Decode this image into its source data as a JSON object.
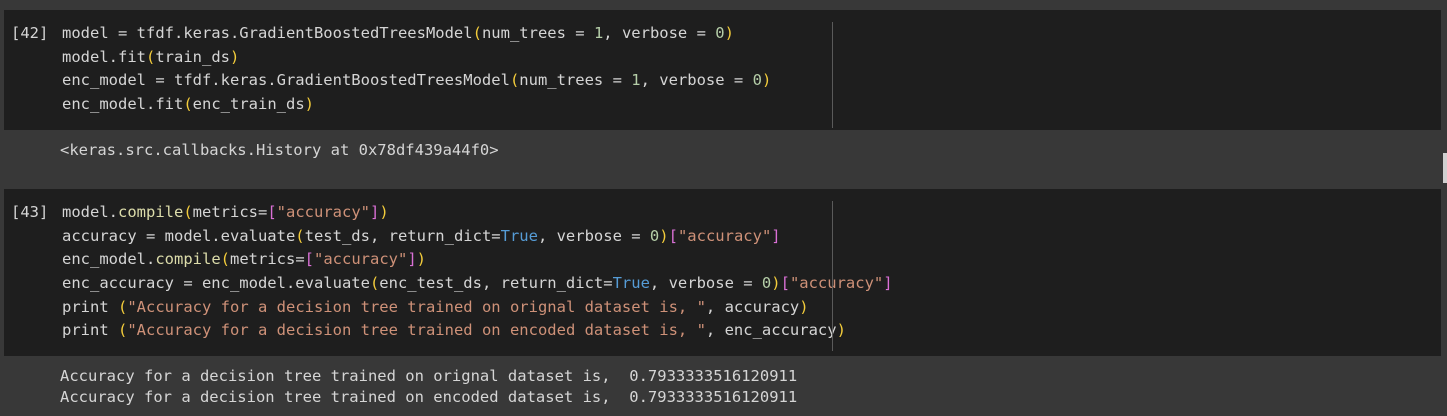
{
  "cells": [
    {
      "exec_count": "[42]",
      "lines": [
        [
          [
            "t",
            "model = tfdf.keras.GradientBoostedTreesModel"
          ],
          [
            "p",
            "("
          ],
          [
            "t",
            "num_trees = "
          ],
          [
            "n",
            "1"
          ],
          [
            "t",
            ", verbose = "
          ],
          [
            "n",
            "0"
          ],
          [
            "p",
            ")"
          ]
        ],
        [
          [
            "t",
            "model.fit"
          ],
          [
            "p",
            "("
          ],
          [
            "t",
            "train_ds"
          ],
          [
            "p",
            ")"
          ]
        ],
        [
          [
            "t",
            "enc_model = tfdf.keras.GradientBoostedTreesModel"
          ],
          [
            "p",
            "("
          ],
          [
            "t",
            "num_trees = "
          ],
          [
            "n",
            "1"
          ],
          [
            "t",
            ", verbose = "
          ],
          [
            "n",
            "0"
          ],
          [
            "p",
            ")"
          ]
        ],
        [
          [
            "t",
            "enc_model.fit"
          ],
          [
            "p",
            "("
          ],
          [
            "t",
            "enc_train_ds"
          ],
          [
            "p",
            ")"
          ]
        ]
      ],
      "output": [
        "<keras.src.callbacks.History at 0x78df439a44f0>"
      ]
    },
    {
      "exec_count": "[43]",
      "lines": [
        [
          [
            "t",
            "model."
          ],
          [
            "f",
            "compile"
          ],
          [
            "p",
            "("
          ],
          [
            "t",
            "metrics="
          ],
          [
            "b",
            "["
          ],
          [
            "s",
            "\"accuracy\""
          ],
          [
            "b",
            "]"
          ],
          [
            "p",
            ")"
          ]
        ],
        [
          [
            "t",
            "accuracy = model.evaluate"
          ],
          [
            "p",
            "("
          ],
          [
            "t",
            "test_ds, return_dict="
          ],
          [
            "k",
            "True"
          ],
          [
            "t",
            ", verbose = "
          ],
          [
            "n",
            "0"
          ],
          [
            "p",
            ")"
          ],
          [
            "b",
            "["
          ],
          [
            "s",
            "\"accuracy\""
          ],
          [
            "b",
            "]"
          ]
        ],
        [
          [
            "t",
            "enc_model."
          ],
          [
            "f",
            "compile"
          ],
          [
            "p",
            "("
          ],
          [
            "t",
            "metrics="
          ],
          [
            "b",
            "["
          ],
          [
            "s",
            "\"accuracy\""
          ],
          [
            "b",
            "]"
          ],
          [
            "p",
            ")"
          ]
        ],
        [
          [
            "t",
            "enc_accuracy = enc_model.evaluate"
          ],
          [
            "p",
            "("
          ],
          [
            "t",
            "enc_test_ds, return_dict="
          ],
          [
            "k",
            "True"
          ],
          [
            "t",
            ", verbose = "
          ],
          [
            "n",
            "0"
          ],
          [
            "p",
            ")"
          ],
          [
            "b",
            "["
          ],
          [
            "s",
            "\"accuracy\""
          ],
          [
            "b",
            "]"
          ]
        ],
        [
          [
            "t",
            "print "
          ],
          [
            "p",
            "("
          ],
          [
            "s",
            "\"Accuracy for a decision tree trained on orignal dataset is, \""
          ],
          [
            "t",
            ", accuracy"
          ],
          [
            "p",
            ")"
          ]
        ],
        [
          [
            "t",
            "print "
          ],
          [
            "p",
            "("
          ],
          [
            "s",
            "\"Accuracy for a decision tree trained on encoded dataset is, \""
          ],
          [
            "t",
            ", enc_accuracy"
          ],
          [
            "p",
            ")"
          ]
        ]
      ],
      "output": [
        "Accuracy for a decision tree trained on orignal dataset is,  0.7933333516120911",
        "Accuracy for a decision tree trained on encoded dataset is,  0.7933333516120911"
      ]
    }
  ]
}
